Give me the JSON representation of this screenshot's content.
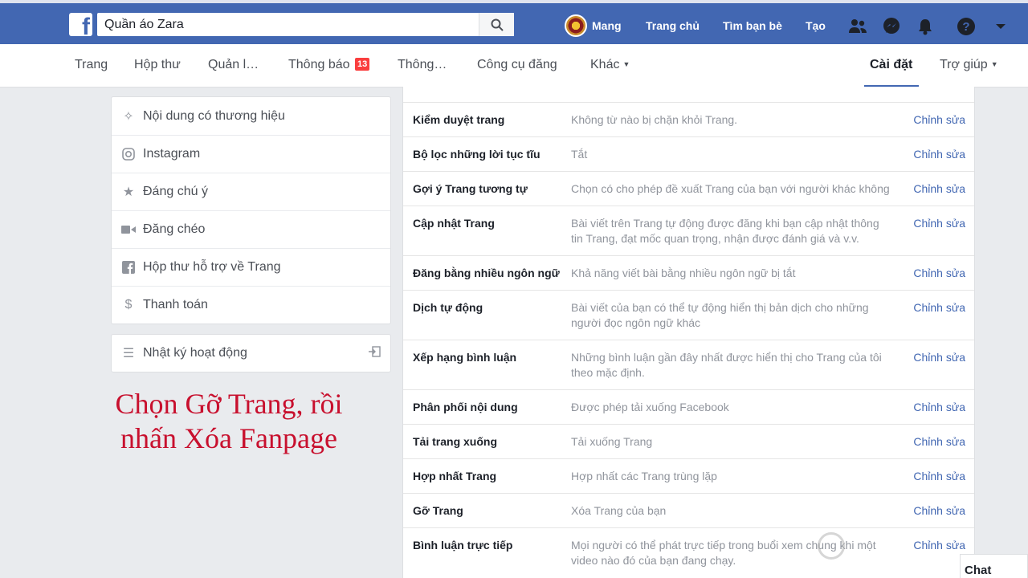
{
  "topbar": {
    "search_value": "Quần áo Zara",
    "user_name": "Mang",
    "links": [
      "Trang chủ",
      "Tìm bạn bè",
      "Tạo"
    ],
    "icons": [
      "friends-icon",
      "messenger-icon",
      "notifications-icon",
      "help-icon",
      "dropdown-icon"
    ]
  },
  "subnav": {
    "page": "Trang",
    "inbox": "Hộp thư",
    "manage": "Quản l…",
    "notifications": "Thông báo",
    "notifications_count": "13",
    "insights": "Thông…",
    "publishing_tools": "Công cụ đăng",
    "more": "Khác",
    "settings": "Cài đặt",
    "help": "Trợ giúp"
  },
  "sidebar": {
    "items": [
      {
        "label": "Nội dung có thương hiệu",
        "icon": "branded-content-icon"
      },
      {
        "label": "Instagram",
        "icon": "instagram-icon"
      },
      {
        "label": "Đáng chú ý",
        "icon": "star-icon"
      },
      {
        "label": "Đăng chéo",
        "icon": "video-camera-icon"
      },
      {
        "label": "Hộp thư hỗ trợ về Trang",
        "icon": "facebook-icon"
      },
      {
        "label": "Thanh toán",
        "icon": "dollar-icon"
      }
    ],
    "activity_log": "Nhật ký hoạt động"
  },
  "caption": {
    "line1": "Chọn Gỡ Trang, rồi",
    "line2": "nhấn Xóa Fanpage"
  },
  "settings_rows": [
    {
      "label": "Kiểm duyệt trang",
      "desc": "Không từ nào bị chặn khỏi Trang.",
      "edit": "Chỉnh sửa"
    },
    {
      "label": "Bộ lọc những lời tục tĩu",
      "desc": "Tắt",
      "edit": "Chỉnh sửa"
    },
    {
      "label": "Gợi ý Trang tương tự",
      "desc": "Chọn có cho phép đề xuất Trang của bạn với người khác không",
      "edit": "Chỉnh sửa"
    },
    {
      "label": "Cập nhật Trang",
      "desc": "Bài viết trên Trang tự động được đăng khi bạn cập nhật thông tin Trang, đạt mốc quan trọng, nhận được đánh giá và v.v.",
      "edit": "Chỉnh sửa"
    },
    {
      "label": "Đăng bằng nhiều ngôn ngữ",
      "desc": "Khả năng viết bài bằng nhiều ngôn ngữ bị tắt",
      "edit": "Chỉnh sửa"
    },
    {
      "label": "Dịch tự động",
      "desc": "Bài viết của bạn có thể tự động hiển thị bản dịch cho những người đọc ngôn ngữ khác",
      "edit": "Chỉnh sửa"
    },
    {
      "label": "Xếp hạng bình luận",
      "desc": "Những bình luận gần đây nhất được hiển thị cho Trang của tôi theo mặc định.",
      "edit": "Chỉnh sửa"
    },
    {
      "label": "Phân phối nội dung",
      "desc": "Được phép tải xuống Facebook",
      "edit": "Chỉnh sửa"
    },
    {
      "label": "Tải trang xuống",
      "desc": "Tải xuống Trang",
      "edit": "Chỉnh sửa"
    },
    {
      "label": "Hợp nhất Trang",
      "desc": "Hợp nhất các Trang trùng lặp",
      "edit": "Chỉnh sửa"
    },
    {
      "label": "Gỡ Trang",
      "desc": "Xóa Trang của bạn",
      "edit": "Chỉnh sửa"
    },
    {
      "label": "Bình luận trực tiếp",
      "desc": "Mọi người có thể phát trực tiếp trong buổi xem chung khi một video nào đó của bạn đang chạy.",
      "edit": "Chỉnh sửa"
    }
  ],
  "chat_label": "Chat",
  "colors": {
    "brand": "#4267b2",
    "caption": "#c8102e",
    "badge": "#fa3e3e"
  }
}
